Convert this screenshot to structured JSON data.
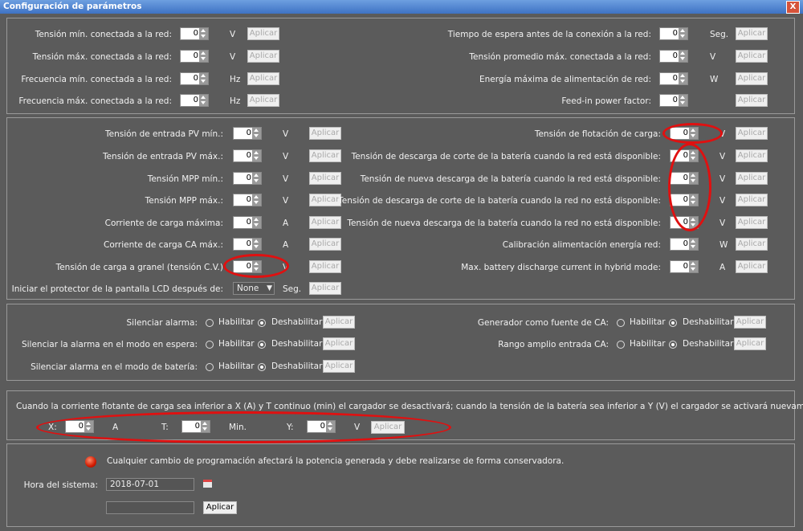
{
  "window": {
    "title": "Configuración de parámetros",
    "close": "X"
  },
  "apply_label": "Aplicar",
  "section1": {
    "left": [
      {
        "label": "Tensión mín. conectada a la red:",
        "value": "0",
        "unit": "V"
      },
      {
        "label": "Tensión máx. conectada a la red:",
        "value": "0",
        "unit": "V"
      },
      {
        "label": "Frecuencia mín. conectada a la red:",
        "value": "0",
        "unit": "Hz"
      },
      {
        "label": "Frecuencia máx. conectada a la red:",
        "value": "0",
        "unit": "Hz"
      }
    ],
    "right": [
      {
        "label": "Tiempo de espera antes de la conexión a la red:",
        "value": "0",
        "unit": "Seg."
      },
      {
        "label": "Tensión promedio máx. conectada a la red:",
        "value": "0",
        "unit": "V"
      },
      {
        "label": "Energía máxima de alimentación de red:",
        "value": "0",
        "unit": "W"
      },
      {
        "label": "Feed-in power factor:",
        "value": "0",
        "unit": ""
      }
    ]
  },
  "section2": {
    "left": [
      {
        "label": "Tensión de entrada PV mín.:",
        "value": "0",
        "unit": "V"
      },
      {
        "label": "Tensión de entrada PV máx.:",
        "value": "0",
        "unit": "V"
      },
      {
        "label": "Tensión MPP mín.:",
        "value": "0",
        "unit": "V"
      },
      {
        "label": "Tensión MPP máx.:",
        "value": "0",
        "unit": "V"
      },
      {
        "label": "Corriente de carga máxima:",
        "value": "0",
        "unit": "A"
      },
      {
        "label": "Corriente de carga CA máx.:",
        "value": "0",
        "unit": "A"
      },
      {
        "label": "Tensión de carga a granel (tensión C.V.)",
        "value": "0",
        "unit": "V"
      }
    ],
    "lcd": {
      "label": "Iniciar el protector de la pantalla LCD después de:",
      "value": "None",
      "unit": "Seg."
    },
    "right": [
      {
        "label": "Tensión de flotación de carga:",
        "value": "0",
        "unit": "V"
      },
      {
        "label": "Tensión de descarga de corte de la batería cuando la red está disponible:",
        "value": "0",
        "unit": "V"
      },
      {
        "label": "Tensión de nueva descarga de la batería cuando la red está disponible:",
        "value": "0",
        "unit": "V"
      },
      {
        "label": "Tensión de descarga de corte de la batería cuando la red no está disponible:",
        "value": "0",
        "unit": "V"
      },
      {
        "label": "Tensión de nueva descarga de la batería cuando la red no está disponible:",
        "value": "0",
        "unit": "V"
      },
      {
        "label": "Calibración alimentación energía red:",
        "value": "0",
        "unit": "W"
      },
      {
        "label": "Max. battery discharge current in hybrid mode:",
        "value": "0",
        "unit": "A"
      }
    ]
  },
  "section3": {
    "enable": "Habilitar",
    "disable": "Deshabilitar",
    "left": [
      {
        "label": "Silenciar alarma:"
      },
      {
        "label": "Silenciar la alarma en el modo en espera:"
      },
      {
        "label": "Silenciar alarma en el modo de batería:"
      }
    ],
    "right": [
      {
        "label": "Generador como fuente de CA:"
      },
      {
        "label": "Rango amplio entrada CA:"
      }
    ]
  },
  "section4": {
    "description": "Cuando la corriente flotante de carga sea inferior a X (A) y T continuo (min) el cargador se desactivará; cuando la tensión de la batería sea inferior a Y (V) el cargador se activará nuevamente.",
    "x": {
      "label": "X:",
      "value": "0",
      "unit": "A"
    },
    "t": {
      "label": "T:",
      "value": "0",
      "unit": "Min."
    },
    "y": {
      "label": "Y:",
      "value": "0",
      "unit": "V"
    }
  },
  "section5": {
    "warning": "Cualquier cambio de programación afectará la potencia generada y debe realizarse de forma conservadora.",
    "system_time_label": "Hora del sistema:",
    "date": "2018-07-01",
    "time": "",
    "apply": "Aplicar"
  }
}
